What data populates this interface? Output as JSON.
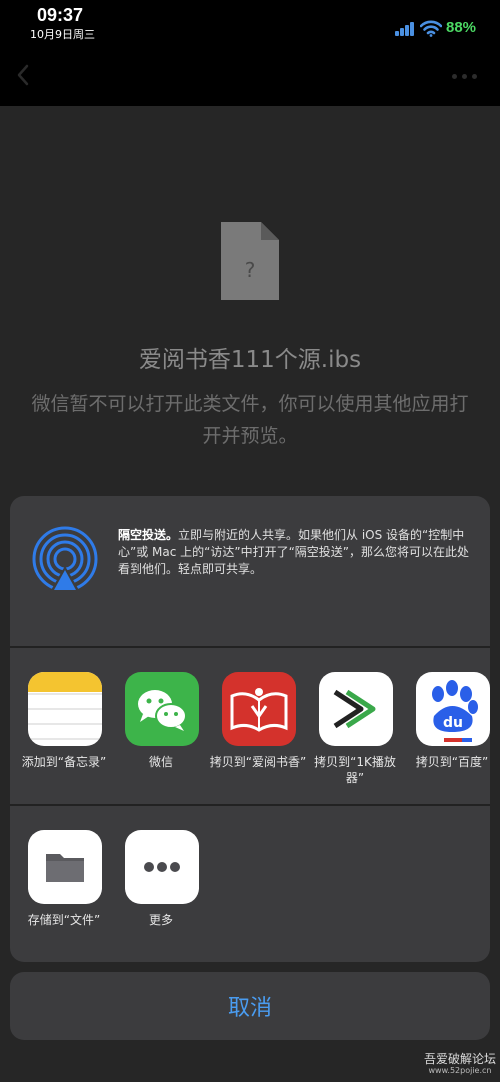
{
  "status_bar": {
    "time": "09:37",
    "date": "10月9日周三",
    "battery": "88%"
  },
  "file": {
    "icon_glyph": "?",
    "name": "爱阅书香111个源.ibs",
    "message": "微信暂不可以打开此类文件，你可以使用其他应用打开并预览。"
  },
  "share_sheet": {
    "airdrop": {
      "title": "隔空投送。",
      "description": "立即与附近的人共享。如果他们从 iOS 设备的“控制中心”或 Mac 上的“访达”中打开了“隔空投送”，那么您将可以在此处看到他们。轻点即可共享。"
    },
    "apps": [
      {
        "label": "添加到“备忘录”",
        "icon": "notes-icon"
      },
      {
        "label": "微信",
        "icon": "wechat-icon"
      },
      {
        "label": "拷贝到“爱阅书香”",
        "icon": "aiyue-book-icon"
      },
      {
        "label": "拷贝到“1K播放器”",
        "icon": "1k-player-icon"
      },
      {
        "label": "拷贝到“百度”",
        "icon": "baidu-icon"
      }
    ],
    "actions": [
      {
        "label": "存储到“文件”",
        "icon": "folder-icon"
      },
      {
        "label": "更多",
        "icon": "more-dots-icon"
      }
    ]
  },
  "cancel_label": "取消",
  "watermark": {
    "title": "吾爱破解论坛",
    "url": "www.52pojie.cn"
  },
  "colors": {
    "accent": "#4a9cf0",
    "battery": "#4cd964",
    "sheet_bg": "#3c3c3e",
    "wechat_green": "#3db44a",
    "aiyue_red": "#d4322c"
  }
}
